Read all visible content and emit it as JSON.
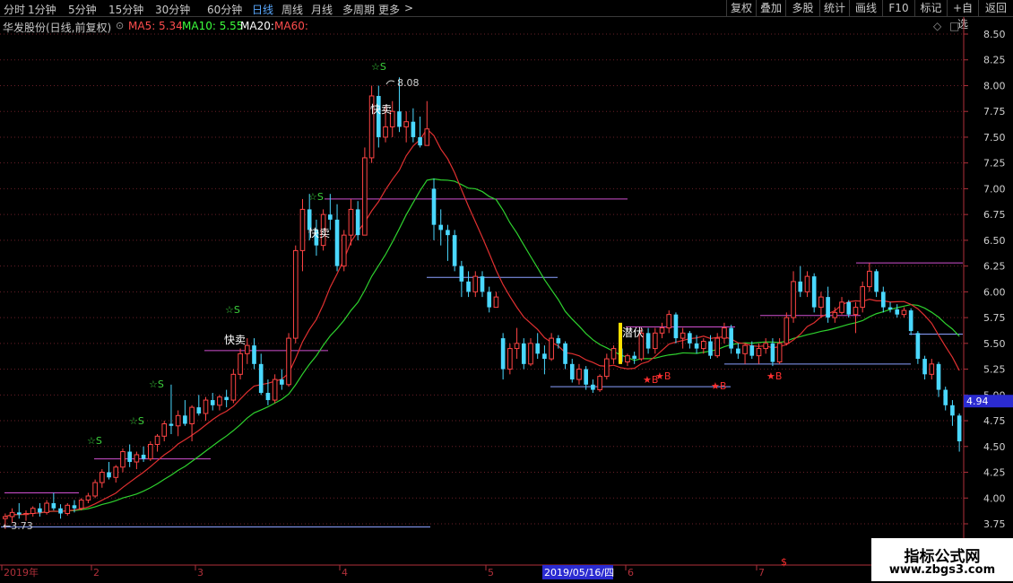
{
  "toolbar": {
    "tabs": [
      "分时",
      "1分钟",
      "5分钟",
      "15分钟",
      "30分钟",
      "60分钟",
      "日线",
      "周线",
      "月线",
      "多周期",
      "更多"
    ],
    "active_tab": "日线",
    "right_buttons": [
      "复权",
      "叠加",
      "多股",
      "统计",
      "画线",
      "F10",
      "标记",
      "+自选",
      "返回"
    ]
  },
  "header": {
    "stock_title": "华发股份(日线,前复权)",
    "ma5": "MA5: 5.34",
    "ma10": "MA10: 5.55",
    "ma20": "MA20:",
    "ma60": "MA60:"
  },
  "chart_data": {
    "type": "candlestick",
    "y_axis_ticks": [
      "8.50",
      "8.25",
      "8.00",
      "7.75",
      "7.50",
      "7.25",
      "7.00",
      "6.75",
      "6.50",
      "6.25",
      "6.00",
      "5.75",
      "5.50",
      "5.25",
      "5.00",
      "4.75",
      "4.50",
      "4.25",
      "4.00",
      "3.75"
    ],
    "ylim": [
      3.6,
      8.6
    ],
    "x_axis_labels": [
      "2019年",
      "2",
      "3",
      "4",
      "5",
      "2019/05/16/四",
      "6",
      "7"
    ],
    "current_price_label": "4.94",
    "high_marker": "8.08",
    "low_marker": "3.73",
    "candles": [
      [
        3.8,
        3.85,
        3.7,
        3.82
      ],
      [
        3.82,
        3.9,
        3.76,
        3.86
      ],
      [
        3.86,
        3.95,
        3.8,
        3.84
      ],
      [
        3.84,
        3.88,
        3.78,
        3.85
      ],
      [
        3.85,
        3.92,
        3.82,
        3.9
      ],
      [
        3.9,
        3.95,
        3.82,
        3.86
      ],
      [
        3.86,
        3.98,
        3.84,
        3.95
      ],
      [
        3.95,
        4.05,
        3.88,
        3.9
      ],
      [
        3.9,
        3.94,
        3.8,
        3.85
      ],
      [
        3.85,
        3.95,
        3.83,
        3.93
      ],
      [
        3.93,
        3.98,
        3.86,
        3.9
      ],
      [
        3.9,
        4.0,
        3.88,
        3.98
      ],
      [
        3.98,
        4.05,
        3.95,
        4.02
      ],
      [
        4.02,
        4.18,
        4.0,
        4.15
      ],
      [
        4.15,
        4.28,
        4.1,
        4.25
      ],
      [
        4.25,
        4.35,
        4.18,
        4.2
      ],
      [
        4.2,
        4.32,
        4.15,
        4.3
      ],
      [
        4.3,
        4.48,
        4.25,
        4.45
      ],
      [
        4.45,
        4.52,
        4.3,
        4.35
      ],
      [
        4.35,
        4.45,
        4.28,
        4.42
      ],
      [
        4.42,
        4.5,
        4.35,
        4.38
      ],
      [
        4.38,
        4.55,
        4.36,
        4.52
      ],
      [
        4.52,
        4.62,
        4.45,
        4.6
      ],
      [
        4.6,
        4.75,
        4.55,
        4.72
      ],
      [
        4.72,
        5.1,
        4.62,
        4.7
      ],
      [
        4.7,
        4.85,
        4.6,
        4.8
      ],
      [
        4.8,
        4.95,
        4.7,
        4.72
      ],
      [
        4.72,
        4.9,
        4.55,
        4.88
      ],
      [
        4.88,
        5.0,
        4.8,
        4.82
      ],
      [
        4.82,
        4.98,
        4.75,
        4.95
      ],
      [
        4.95,
        5.02,
        4.85,
        4.9
      ],
      [
        4.9,
        5.0,
        4.85,
        4.98
      ],
      [
        4.98,
        5.05,
        4.88,
        4.95
      ],
      [
        4.95,
        5.25,
        4.92,
        5.2
      ],
      [
        5.2,
        5.45,
        5.15,
        5.4
      ],
      [
        5.4,
        5.55,
        5.3,
        5.48
      ],
      [
        5.48,
        5.55,
        5.25,
        5.3
      ],
      [
        5.3,
        5.4,
        5.0,
        5.02
      ],
      [
        5.02,
        5.15,
        4.9,
        4.95
      ],
      [
        4.95,
        5.2,
        4.92,
        5.15
      ],
      [
        5.15,
        5.25,
        5.05,
        5.1
      ],
      [
        5.1,
        5.6,
        5.08,
        5.55
      ],
      [
        5.55,
        6.45,
        5.5,
        6.4
      ],
      [
        6.4,
        6.9,
        6.2,
        6.8
      ],
      [
        6.8,
        6.95,
        6.5,
        6.6
      ],
      [
        6.6,
        6.7,
        6.35,
        6.45
      ],
      [
        6.45,
        6.8,
        6.4,
        6.75
      ],
      [
        6.75,
        6.95,
        6.6,
        6.7
      ],
      [
        6.7,
        6.85,
        6.2,
        6.25
      ],
      [
        6.25,
        6.6,
        6.2,
        6.55
      ],
      [
        6.55,
        6.9,
        6.45,
        6.8
      ],
      [
        6.8,
        6.88,
        6.5,
        6.55
      ],
      [
        6.55,
        7.4,
        6.55,
        7.3
      ],
      [
        7.3,
        8.0,
        7.25,
        7.9
      ],
      [
        7.9,
        8.0,
        7.4,
        7.5
      ],
      [
        7.5,
        7.8,
        7.45,
        7.6
      ],
      [
        7.6,
        7.85,
        7.5,
        7.75
      ],
      [
        7.75,
        8.08,
        7.55,
        7.6
      ],
      [
        7.6,
        7.75,
        7.45,
        7.65
      ],
      [
        7.65,
        7.78,
        7.45,
        7.5
      ],
      [
        7.5,
        7.7,
        7.4,
        7.42
      ],
      [
        7.42,
        7.85,
        7.42,
        7.58
      ],
      [
        7.0,
        7.1,
        6.5,
        6.65
      ],
      [
        6.65,
        6.8,
        6.45,
        6.6
      ],
      [
        6.6,
        6.65,
        6.3,
        6.55
      ],
      [
        6.55,
        6.6,
        6.2,
        6.25
      ],
      [
        6.25,
        6.3,
        5.95,
        6.1
      ],
      [
        6.1,
        6.2,
        5.95,
        6.0
      ],
      [
        6.0,
        6.2,
        5.95,
        6.15
      ],
      [
        6.15,
        6.2,
        5.95,
        6.0
      ],
      [
        6.0,
        6.05,
        5.8,
        5.85
      ],
      [
        5.85,
        6.0,
        5.85,
        5.95
      ],
      [
        5.55,
        5.6,
        5.15,
        5.25
      ],
      [
        5.25,
        5.5,
        5.2,
        5.45
      ],
      [
        5.45,
        5.65,
        5.35,
        5.5
      ],
      [
        5.5,
        5.55,
        5.25,
        5.3
      ],
      [
        5.3,
        5.55,
        5.28,
        5.5
      ],
      [
        5.5,
        5.6,
        5.35,
        5.4
      ],
      [
        5.4,
        5.48,
        5.2,
        5.35
      ],
      [
        5.35,
        5.6,
        5.33,
        5.55
      ],
      [
        5.55,
        5.58,
        5.45,
        5.5
      ],
      [
        5.5,
        5.52,
        5.25,
        5.3
      ],
      [
        5.3,
        5.35,
        5.12,
        5.15
      ],
      [
        5.15,
        5.3,
        5.1,
        5.25
      ],
      [
        5.25,
        5.28,
        5.05,
        5.1
      ],
      [
        5.1,
        5.15,
        5.02,
        5.05
      ],
      [
        5.05,
        5.2,
        5.03,
        5.18
      ],
      [
        5.18,
        5.4,
        5.15,
        5.35
      ],
      [
        5.35,
        5.48,
        5.3,
        5.45
      ],
      [
        5.45,
        5.5,
        5.3,
        5.32
      ],
      [
        5.32,
        5.4,
        5.28,
        5.38
      ],
      [
        5.38,
        5.42,
        5.3,
        5.35
      ],
      [
        5.35,
        5.65,
        5.33,
        5.6
      ],
      [
        5.6,
        5.65,
        5.4,
        5.45
      ],
      [
        5.45,
        5.65,
        5.4,
        5.6
      ],
      [
        5.6,
        5.7,
        5.55,
        5.65
      ],
      [
        5.65,
        5.82,
        5.6,
        5.78
      ],
      [
        5.78,
        5.8,
        5.5,
        5.55
      ],
      [
        5.55,
        5.65,
        5.45,
        5.6
      ],
      [
        5.6,
        5.62,
        5.45,
        5.5
      ],
      [
        5.5,
        5.58,
        5.4,
        5.45
      ],
      [
        5.45,
        5.55,
        5.4,
        5.52
      ],
      [
        5.52,
        5.58,
        5.35,
        5.38
      ],
      [
        5.38,
        5.6,
        5.36,
        5.55
      ],
      [
        5.55,
        5.7,
        5.5,
        5.65
      ],
      [
        5.65,
        5.68,
        5.4,
        5.45
      ],
      [
        5.45,
        5.5,
        5.35,
        5.4
      ],
      [
        5.4,
        5.5,
        5.3,
        5.48
      ],
      [
        5.48,
        5.52,
        5.35,
        5.38
      ],
      [
        5.38,
        5.5,
        5.3,
        5.45
      ],
      [
        5.45,
        5.55,
        5.4,
        5.5
      ],
      [
        5.5,
        5.55,
        5.28,
        5.32
      ],
      [
        5.32,
        5.55,
        5.3,
        5.5
      ],
      [
        5.5,
        5.8,
        5.48,
        5.75
      ],
      [
        5.75,
        6.2,
        5.7,
        6.1
      ],
      [
        6.1,
        6.25,
        5.95,
        6.0
      ],
      [
        6.0,
        6.2,
        5.95,
        6.15
      ],
      [
        6.15,
        6.18,
        5.8,
        5.85
      ],
      [
        5.85,
        6.0,
        5.75,
        5.95
      ],
      [
        5.95,
        6.05,
        5.7,
        5.75
      ],
      [
        5.75,
        5.85,
        5.7,
        5.8
      ],
      [
        5.8,
        5.95,
        5.78,
        5.9
      ],
      [
        5.9,
        5.92,
        5.75,
        5.78
      ],
      [
        5.78,
        5.9,
        5.6,
        5.85
      ],
      [
        5.85,
        6.1,
        5.8,
        6.05
      ],
      [
        6.05,
        6.28,
        6.0,
        6.2
      ],
      [
        6.2,
        6.22,
        5.95,
        6.0
      ],
      [
        6.0,
        6.05,
        5.8,
        5.85
      ],
      [
        5.85,
        5.9,
        5.8,
        5.83
      ],
      [
        5.83,
        5.88,
        5.75,
        5.78
      ],
      [
        5.78,
        5.85,
        5.75,
        5.82
      ],
      [
        5.82,
        5.84,
        5.58,
        5.62
      ],
      [
        5.6,
        5.62,
        5.3,
        5.35
      ],
      [
        5.35,
        5.38,
        5.15,
        5.2
      ],
      [
        5.2,
        5.35,
        5.15,
        5.3
      ],
      [
        5.3,
        5.32,
        4.98,
        5.05
      ],
      [
        5.05,
        5.08,
        4.85,
        4.9
      ],
      [
        4.9,
        4.95,
        4.7,
        4.8
      ],
      [
        4.8,
        4.82,
        4.45,
        4.55
      ]
    ],
    "annotations": [
      "☆S",
      "快卖",
      "8.08",
      "潜伏",
      "★B"
    ]
  },
  "watermark": {
    "line1": "指标公式网",
    "line2": "www.zbgs3.com"
  }
}
